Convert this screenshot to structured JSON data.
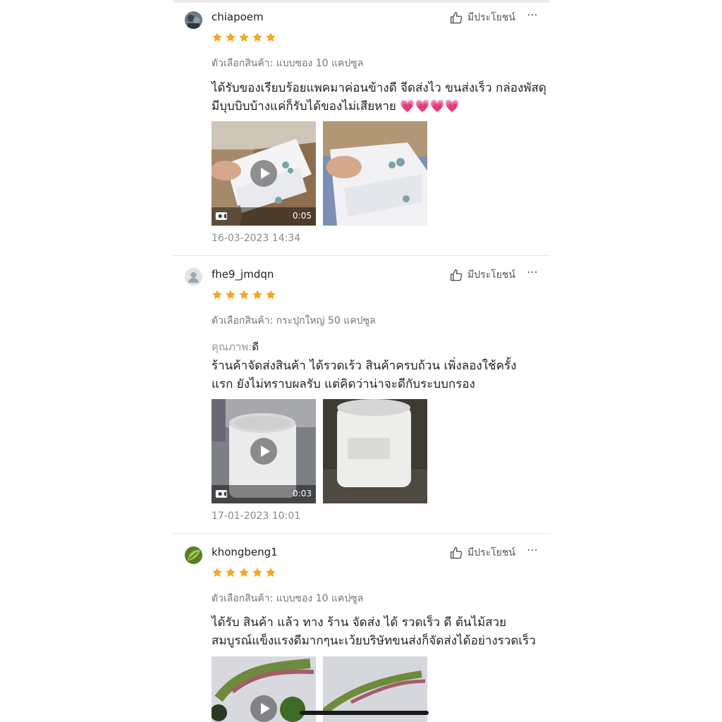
{
  "helpful_label": "มีประโยชน์",
  "reviews": [
    {
      "username": "chiapoem",
      "rating": 5,
      "variant": "ตัวเลือกสินค้า: แบบซอง 10 แคปซูล",
      "text_lines": [
        "ได้รับของเรียบร้อยแพคมาค่อนข้างดี จีดส่งไว ขนส่งเร็ว กล่องพัสดุ",
        "มีบุบบิบบ้างแค่ก็รับได้ของไม่เสียหาย 💗💗💗💗"
      ],
      "media": [
        {
          "type": "video",
          "duration": "0:05"
        },
        {
          "type": "image"
        }
      ],
      "date": "16-03-2023 14:34"
    },
    {
      "username": "fhe9_jmdqn",
      "rating": 5,
      "variant": "ตัวเลือกสินค้า: กระปุกใหญ่ 50 แคปซูล",
      "quality_label": "คุณภาพ:",
      "quality_value": "ดี",
      "text_lines": [
        "ร้านค้าจัดส่งสินค้า ได้รวดเร้ว    สินค้าครบถ้วน   เพิ่งลองใช้ครั้ง",
        "แรก ยังไม่ทราบผลรับ แต่คิดว่าน่าจะดีกับระบบกรอง"
      ],
      "media": [
        {
          "type": "video",
          "duration": "0:03"
        },
        {
          "type": "image"
        }
      ],
      "date": "17-01-2023 10:01"
    },
    {
      "username": "khongbeng1",
      "rating": 5,
      "variant": "ตัวเลือกสินค้า: แบบซอง 10 แคปซูล",
      "text_lines": [
        "ได้รับ สินค้า แล้ว ทาง ร้าน จัดส่ง ได้ รวดเร็ว ดี   ต้นไม้สวย",
        "สมบูรณ์แข็งแรงดีมากๆนะเว้ยบริษัทขนส่งก็จัดส่งได้อย่างรวดเร็ว"
      ],
      "media": [
        {
          "type": "video"
        },
        {
          "type": "image"
        }
      ]
    }
  ],
  "colors": {
    "star": "#F5A623",
    "divider": "#E6E6E6",
    "muted": "#757575"
  },
  "icons": {
    "helpful": "thumbs-up-icon",
    "more": "more-icon",
    "play": "play-icon",
    "video": "video-camera-icon"
  }
}
